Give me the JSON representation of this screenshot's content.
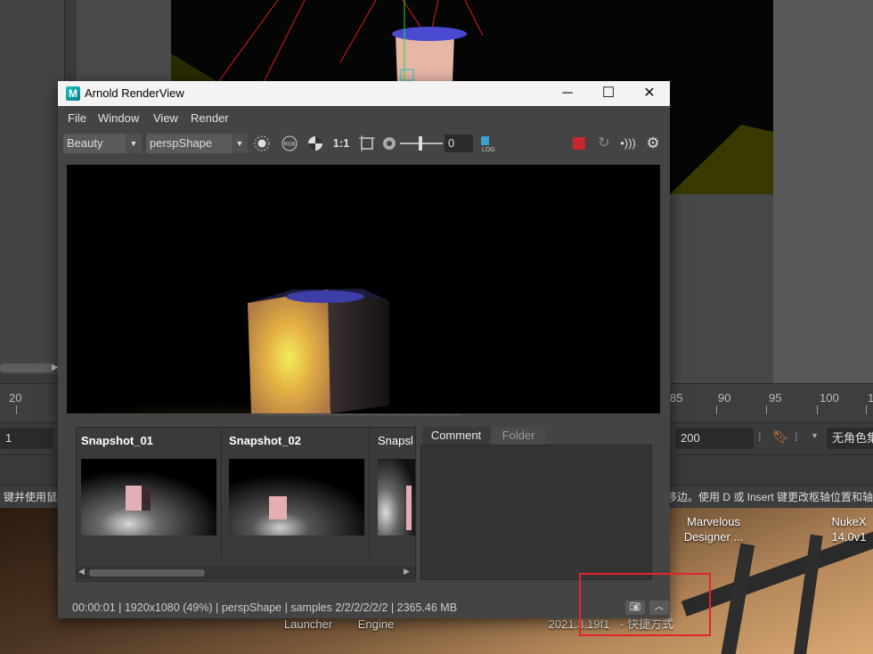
{
  "window": {
    "title": "Arnold RenderView",
    "logo_letter": "M",
    "controls": {
      "minimize": "─",
      "maximize": "☐",
      "close": "✕"
    }
  },
  "menu": [
    "File",
    "Window",
    "View",
    "Render"
  ],
  "toolbar": {
    "aov_select": "Beauty",
    "camera_select": "perspShape",
    "ratio_label": "1:1",
    "exposure_value": "0",
    "rgb_label": "RGB",
    "log_label": "LOG",
    "icons": [
      "ipr-circle-icon",
      "rgb-channel-icon",
      "contrast-icon",
      "ratio-icon",
      "crop-region-icon",
      "aperture-icon",
      "exposure-slider",
      "log-icon",
      "stop-render-icon",
      "refresh-icon",
      "broadcast-icon",
      "settings-gear-icon"
    ],
    "colors": {
      "stop": "#c8262b"
    }
  },
  "snapshots": [
    {
      "name": "Snapshot_01"
    },
    {
      "name": "Snapshot_02"
    },
    {
      "name": "Snapsl"
    }
  ],
  "comment_panel": {
    "tabs": [
      "Comment",
      "Folder"
    ],
    "active_tab": "Comment"
  },
  "status": {
    "text": "00:00:01 | 1920x1080 (49%) | perspShape  | samples 2/2/2/2/2/2 | 2365.46 MB"
  },
  "background": {
    "timeline_ticks": [
      "20",
      "85",
      "90",
      "95",
      "100",
      "1"
    ],
    "range_start": "1",
    "range_end": "200",
    "char_set": "无角色集",
    "help_left": "键并使用鼠标",
    "help_right": "移边。使用 D 或 Insert 键更改枢轴位置和轴方向",
    "desktop_icons": [
      {
        "line1": "Marvelous",
        "line2": "Designer ..."
      },
      {
        "line1": "NukeX",
        "line2": "14.0v1"
      },
      {
        "line1": "Launcher",
        "line2": ""
      },
      {
        "line1": "Engine",
        "line2": ""
      },
      {
        "line1": "2021.3.19f1",
        "line2": ""
      },
      {
        "line1": "- 快捷方式",
        "line2": ""
      }
    ]
  },
  "highlight_color": "#e5232b"
}
